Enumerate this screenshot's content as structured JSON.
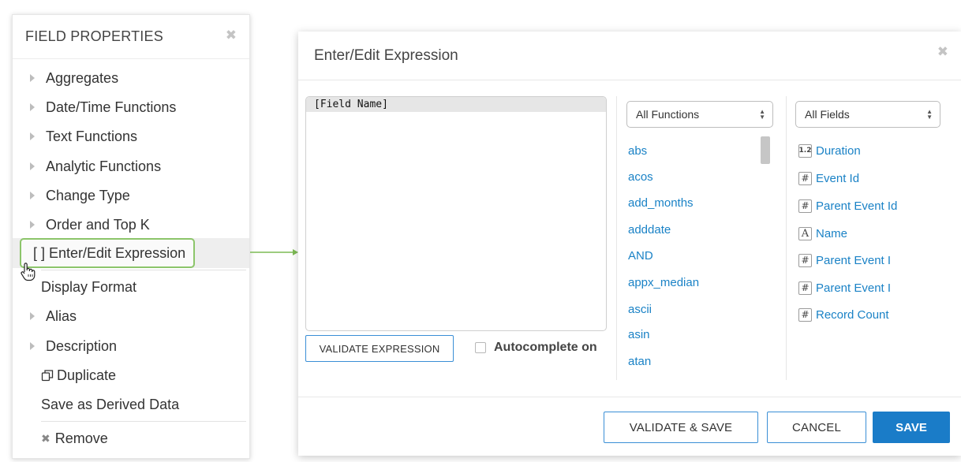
{
  "field_properties": {
    "title": "FIELD PROPERTIES",
    "close_glyph": "✖",
    "items": [
      {
        "label": "Aggregates"
      },
      {
        "label": "Date/Time Functions"
      },
      {
        "label": "Text Functions"
      },
      {
        "label": "Analytic Functions"
      },
      {
        "label": "Change Type"
      },
      {
        "label": "Order and Top K"
      },
      {
        "label": "[ ] Enter/Edit Expression"
      },
      {
        "label": "Display Format"
      },
      {
        "label": "Alias"
      },
      {
        "label": "Description"
      },
      {
        "label": "Duplicate"
      },
      {
        "label": "Save as Derived Data"
      },
      {
        "label": "Remove"
      }
    ]
  },
  "dialog": {
    "title": "Enter/Edit Expression",
    "close_glyph": "✖",
    "expression": "[Field Name]",
    "validate_expression_label": "VALIDATE EXPRESSION",
    "autocomplete_label": "Autocomplete on",
    "autocomplete_checked": false,
    "functions_select": "All Functions",
    "fields_select": "All Fields",
    "functions": [
      "abs",
      "acos",
      "add_months",
      "adddate",
      "AND",
      "appx_median",
      "ascii",
      "asin",
      "atan"
    ],
    "fields": [
      {
        "type_icon": "1.2",
        "label": "Duration"
      },
      {
        "type_icon": "#",
        "label": "Event Id"
      },
      {
        "type_icon": "#",
        "label": "Parent Event Id"
      },
      {
        "type_icon": "A",
        "label": "Name"
      },
      {
        "type_icon": "#",
        "label": "Parent Event I"
      },
      {
        "type_icon": "#",
        "label": "Parent Event I"
      },
      {
        "type_icon": "#",
        "label": "Record Count"
      }
    ],
    "footer": {
      "validate_save_label": "VALIDATE & SAVE",
      "cancel_label": "CANCEL",
      "save_label": "SAVE"
    }
  },
  "colors": {
    "accent_blue": "#1a7cc8",
    "link_blue": "#1a82c6",
    "highlight_green": "#8cc56a"
  }
}
